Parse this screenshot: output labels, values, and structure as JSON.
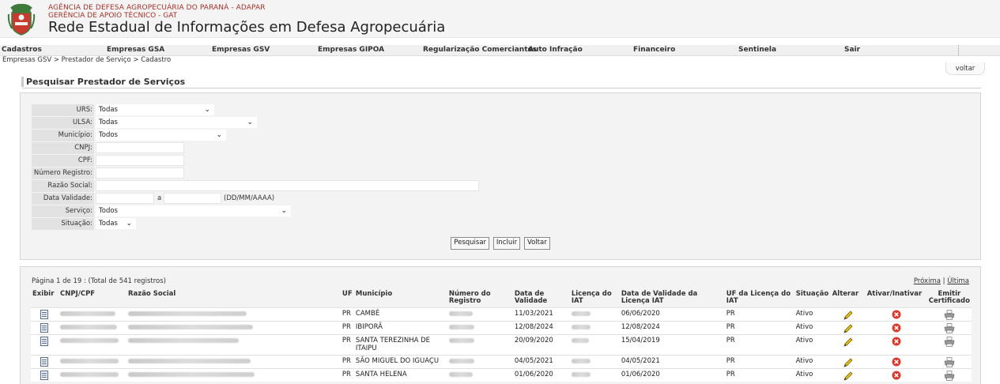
{
  "header": {
    "agency_line1": "AGÊNCIA DE DEFESA AGROPECUÁRIA DO PARANÁ - ADAPAR",
    "agency_line2": "GERÊNCIA DE APOIO TÉCNICO - GAT",
    "system_name": "Rede Estadual de Informações em Defesa Agropecuária",
    "crest_icon": "parana-coat-of-arms-icon"
  },
  "menu": {
    "items": [
      "Cadastros",
      "Empresas GSA",
      "Empresas GSV",
      "Empresas GIPOA",
      "Regularização Comerciantes",
      "Auto Infração",
      "Financeiro",
      "Sentinela",
      "Sair"
    ]
  },
  "breadcrumb": "Empresas GSV > Prestador de Serviço > Cadastro",
  "voltar_tab": "voltar",
  "page_title": "Pesquisar Prestador de Serviços",
  "form": {
    "urs": {
      "label": "URS:",
      "value": "Todas"
    },
    "ulsa": {
      "label": "ULSA:",
      "value": "Todas"
    },
    "municipio": {
      "label": "Município:",
      "value": "Todos"
    },
    "cnpj": {
      "label": "CNPJ:",
      "value": ""
    },
    "cpf": {
      "label": "CPF:",
      "value": ""
    },
    "numero_registro": {
      "label": "Número Registro:",
      "value": ""
    },
    "razao_social": {
      "label": "Razão Social:",
      "value": ""
    },
    "data_validade": {
      "label": "Data Validade:",
      "separator": "a",
      "format_hint": "(DD/MM/AAAA)",
      "from": "",
      "to": ""
    },
    "servico": {
      "label": "Serviço:",
      "value": "Todos"
    },
    "situacao": {
      "label": "Situação:",
      "value": "Todas"
    }
  },
  "buttons": {
    "search": "Pesquisar",
    "include": "Incluir",
    "back": "Voltar"
  },
  "results": {
    "paging": "Página 1 de 19 : (Total de 541 registros)",
    "next": "Próxima",
    "separator": "|",
    "last": "Última",
    "columns": [
      "Exibir",
      "CNPJ/CPF",
      "Razão Social",
      "UF",
      "Município",
      "Número do Registro",
      "Data de Validade",
      "Licença do IAT",
      "Data de Validade da Licença IAT",
      "UF da Licença do IAT",
      "Situação",
      "Alterar",
      "Ativar/Inativar",
      "Emitir Certificado"
    ],
    "rows": [
      {
        "uf": "PR",
        "municipio": "CAMBÉ",
        "data_validade": "11/03/2021",
        "data_validade_licenca": "06/06/2020",
        "uf_licenca": "PR",
        "situacao": "Ativo"
      },
      {
        "uf": "PR",
        "municipio": "IBIPORÃ",
        "data_validade": "12/08/2024",
        "data_validade_licenca": "12/08/2024",
        "uf_licenca": "PR",
        "situacao": "Ativo"
      },
      {
        "uf": "PR",
        "municipio": "SANTA TEREZINHA DE ITAIPU",
        "data_validade": "20/09/2020",
        "data_validade_licenca": "15/04/2019",
        "uf_licenca": "PR",
        "situacao": "Ativo"
      },
      {
        "uf": "PR",
        "municipio": "SÃO MIGUEL DO IGUAÇU",
        "data_validade": "04/05/2021",
        "data_validade_licenca": "04/05/2021",
        "uf_licenca": "PR",
        "situacao": "Ativo"
      },
      {
        "uf": "PR",
        "municipio": "SANTA HELENA",
        "data_validade": "01/06/2020",
        "data_validade_licenca": "01/06/2020",
        "uf_licenca": "PR",
        "situacao": "Ativo"
      }
    ]
  },
  "icons": {
    "view": "document-icon",
    "edit": "pencil-icon",
    "toggle": "red-x-circle-icon",
    "certificate": "printer-icon"
  },
  "colors": {
    "agency_red": "#a8322b",
    "panel_bg": "#f3f3f3",
    "label_bg": "#e2e2e2",
    "toggle_red": "#d93a2b",
    "pencil_yellow": "#e8c21a"
  }
}
